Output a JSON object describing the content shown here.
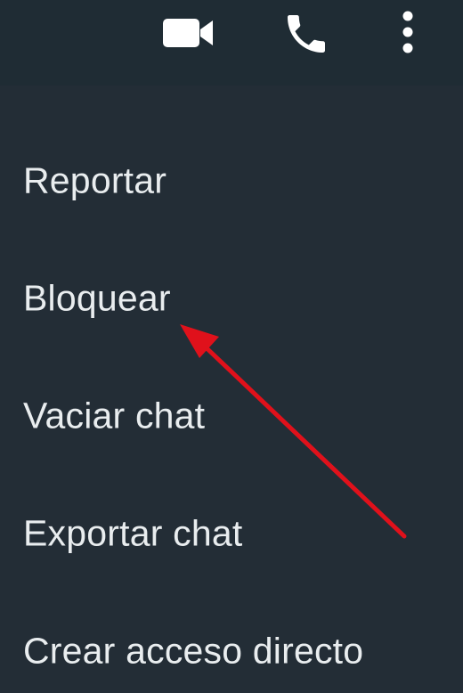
{
  "toolbar": {
    "icons": [
      "video-camera-icon",
      "phone-icon",
      "more-vertical-icon"
    ]
  },
  "menu": {
    "items": [
      {
        "label": "Reportar"
      },
      {
        "label": "Bloquear"
      },
      {
        "label": "Vaciar chat"
      },
      {
        "label": "Exportar chat"
      },
      {
        "label": "Crear acceso directo"
      }
    ]
  },
  "colors": {
    "background": "#232d36",
    "toolbar": "#1f2c34",
    "text": "#e9edef",
    "icon": "#ffffff",
    "annotation_arrow": "#e0111b"
  }
}
